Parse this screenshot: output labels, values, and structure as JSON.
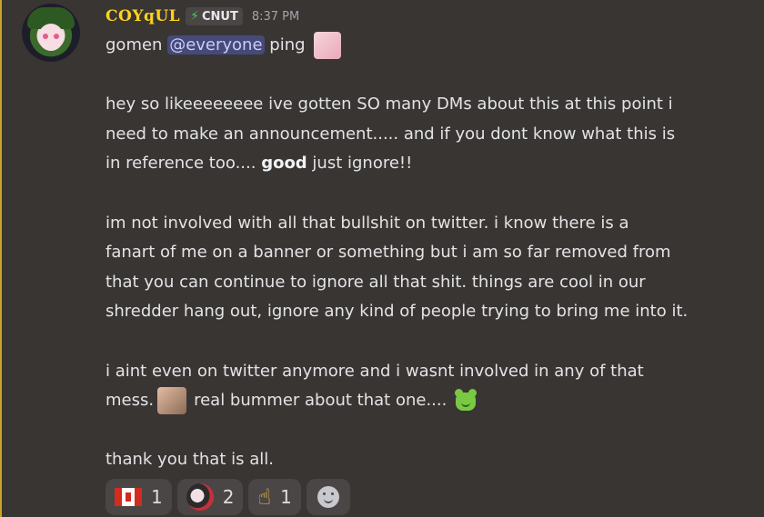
{
  "message": {
    "username": "COYqUL",
    "tag": "CNUT",
    "timestamp": "8:37 PM",
    "lines": {
      "l1a": "gomen ",
      "l1mention": "@everyone",
      "l1b": " ping",
      "l2": "hey so likeeeeeeee ive gotten SO many DMs about this at this point i",
      "l3": "need to make an announcement..... and if you dont know what this is",
      "l4a": "in reference too.... ",
      "l4bold": "good",
      "l4b": " just ignore!!",
      "l5": "im not involved with all that bullshit on twitter. i know there is a",
      "l6": "fanart of me on a banner or something but i am so far removed from",
      "l7": "that you can continue to ignore all that shit.  things are cool in our",
      "l8": "shredder hang out, ignore any kind of people trying to bring me into it.",
      "l9": "i aint even on twitter anymore and i wasnt involved in any of that",
      "l10a": "mess.",
      "l10b": "real bummer about that one....",
      "l11": "thank you that is all."
    }
  },
  "reactions": [
    {
      "emoji": "canada-flag",
      "count": "1"
    },
    {
      "emoji": "custom-avatar-emoji",
      "count": "2"
    },
    {
      "emoji": "pointing-up-hand",
      "count": "1"
    }
  ],
  "icons": {
    "tag_icon": "lightning-bolt-icon",
    "add_reaction_icon": "smiley-add-icon"
  },
  "colors": {
    "background": "#393533",
    "username": "#ffd21f",
    "mention_bg": "#454a78",
    "reaction_bg": "#4a4645"
  }
}
